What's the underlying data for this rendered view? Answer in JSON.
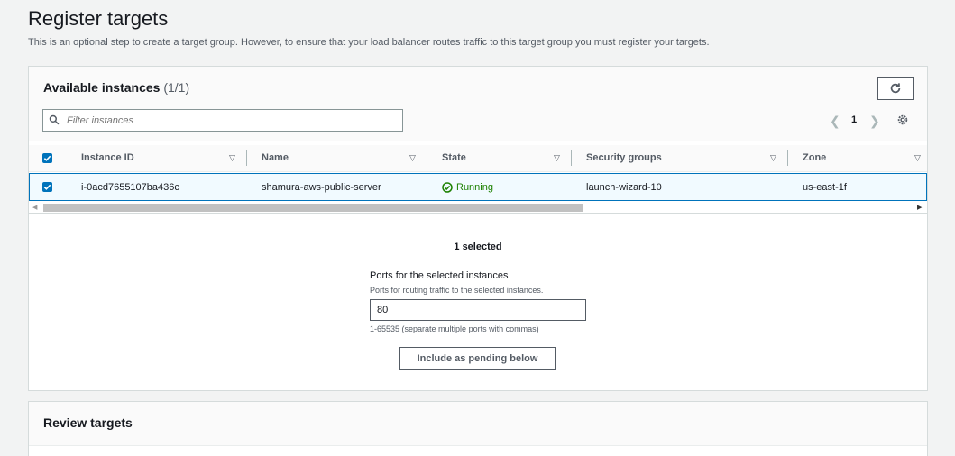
{
  "page": {
    "title": "Register targets",
    "description": "This is an optional step to create a target group. However, to ensure that your load balancer routes traffic to this target group you must register your targets."
  },
  "instances": {
    "title": "Available instances",
    "count": "(1/1)",
    "filter_placeholder": "Filter instances",
    "page_number": "1",
    "columns": [
      "Instance ID",
      "Name",
      "State",
      "Security groups",
      "Zone"
    ],
    "rows": [
      {
        "selected": true,
        "instance_id": "i-0acd7655107ba436c",
        "name": "shamura-aws-public-server",
        "state": "Running",
        "security_groups": "launch-wizard-10",
        "zone": "us-east-1f"
      }
    ]
  },
  "ports": {
    "selected_count": "1 selected",
    "label": "Ports for the selected instances",
    "description": "Ports for routing traffic to the selected instances.",
    "value": "80",
    "hint": "1-65535 (separate multiple ports with commas)",
    "include_button": "Include as pending below"
  },
  "review": {
    "title": "Review targets"
  },
  "colors": {
    "accent": "#0073bb",
    "running": "#1d8102"
  }
}
